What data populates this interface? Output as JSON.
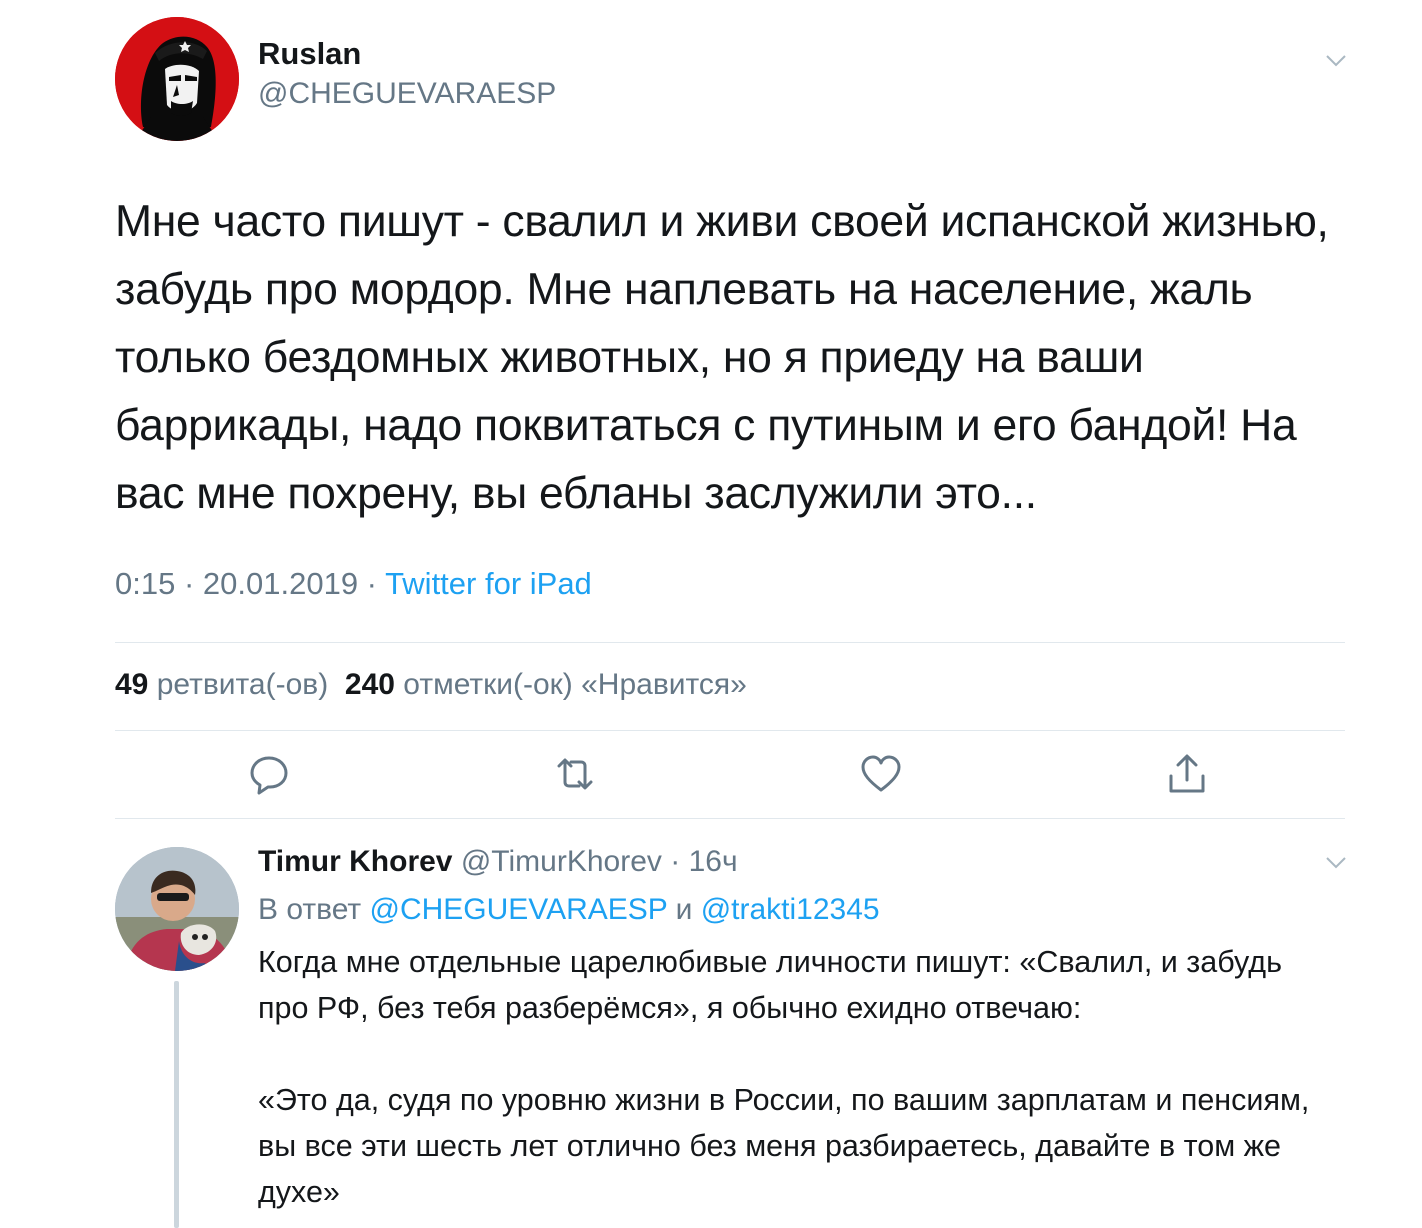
{
  "main_tweet": {
    "author_name": "Ruslan",
    "author_handle": "@CHEGUEVARAESP",
    "text": "Мне часто пишут - свалил и живи своей  испанской жизнью, забудь про мордор. Мне наплевать на население, жаль только бездомных животных, но я приеду на ваши баррикады, надо поквитаться с путиным и его бандой!  На вас мне похрену, вы ебланы заслужили это...",
    "time": "0:15",
    "date": "20.01.2019",
    "separator": " · ",
    "source": "Twitter for iPad",
    "retweets_count": "49",
    "retweets_label": "ретвита(-ов)",
    "likes_count": "240",
    "likes_label": "отметки(-ок) «Нравится»"
  },
  "actions": {
    "reply_icon": "reply-icon",
    "retweet_icon": "retweet-icon",
    "like_icon": "heart-icon",
    "share_icon": "share-icon"
  },
  "reply_tweet": {
    "author_name": "Timur Khorev",
    "author_handle": "@TimurKhorev",
    "separator": " · ",
    "age": "16ч",
    "reply_prefix": "В ответ",
    "mention_1": "@CHEGUEVARAESP",
    "conjunction": "и",
    "mention_2": "@trakti12345",
    "paragraph_1": "Когда мне отдельные царелюбивые личности пишут: «Свалил, и забудь про РФ, без тебя разберёмся», я обычно ехидно отвечаю:",
    "paragraph_2": "«Это да, судя по уровню жизни в России, по вашим зарплатам и пенсиям, вы все эти шесть лет отлично без меня разбираетесь, давайте в том же духе»"
  },
  "colors": {
    "text": "#14171a",
    "secondary": "#657786",
    "accent": "#1da1f2",
    "divider": "#e1e8ed"
  }
}
